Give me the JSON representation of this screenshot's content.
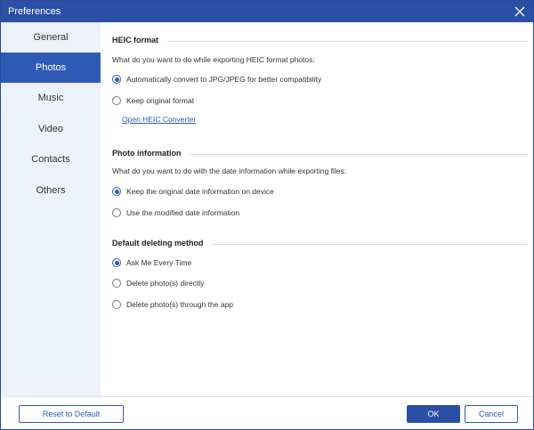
{
  "window": {
    "title": "Preferences"
  },
  "sidebar": {
    "items": [
      {
        "label": "General"
      },
      {
        "label": "Photos",
        "active": true
      },
      {
        "label": "Music"
      },
      {
        "label": "Video"
      },
      {
        "label": "Contacts"
      },
      {
        "label": "Others"
      }
    ]
  },
  "heic": {
    "title": "HEIC format",
    "question": "What do you want to do while exporting HEIC format photos:",
    "options": [
      {
        "label": "Automatically convert to JPG/JPEG for better compatibility",
        "checked": true
      },
      {
        "label": "Keep original format",
        "checked": false
      }
    ],
    "link": "Open HEIC Converter"
  },
  "photo_info": {
    "title": "Photo information",
    "question": "What do you want to do with the date information while exporting files:",
    "options": [
      {
        "label": "Keep the original date information on device",
        "checked": true
      },
      {
        "label": "Use the modified date information",
        "checked": false
      }
    ]
  },
  "deleting": {
    "title": "Default deleting method",
    "options": [
      {
        "label": "Ask Me Every Time",
        "checked": true
      },
      {
        "label": "Delete photo(s) directly",
        "checked": false
      },
      {
        "label": "Delete photo(s) through the app",
        "checked": false
      }
    ]
  },
  "footer": {
    "reset_label": "Reset to Default",
    "ok_label": "OK",
    "cancel_label": "Cancel"
  },
  "colors": {
    "accent": "#2f5bb7",
    "titlebar": "#2a4fa5",
    "sidebar_bg": "#edf1fa"
  }
}
